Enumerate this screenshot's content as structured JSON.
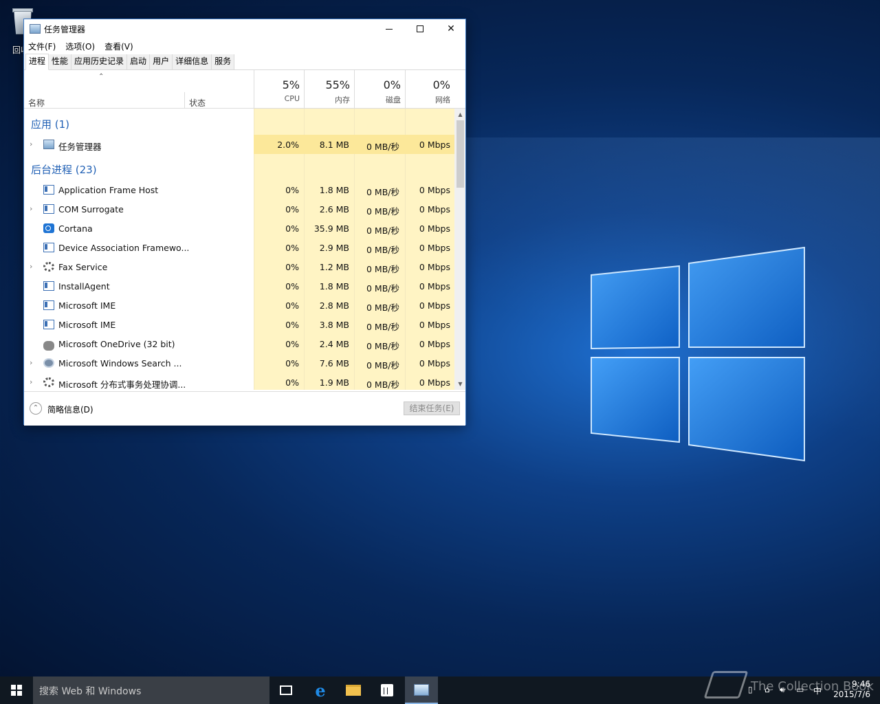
{
  "desktop": {
    "recycle_bin_label": "回收站"
  },
  "window": {
    "title": "任务管理器",
    "menu": [
      "文件(F)",
      "选项(O)",
      "查看(V)"
    ],
    "tabs": [
      "进程",
      "性能",
      "应用历史记录",
      "启动",
      "用户",
      "详细信息",
      "服务"
    ],
    "active_tab_index": 0,
    "columns": {
      "name": "名称",
      "status": "状态",
      "cpu": {
        "percent": "5%",
        "label": "CPU"
      },
      "memory": {
        "percent": "55%",
        "label": "内存"
      },
      "disk": {
        "percent": "0%",
        "label": "磁盘"
      },
      "network": {
        "percent": "0%",
        "label": "网络"
      }
    },
    "groups": {
      "apps": "应用 (1)",
      "background": "后台进程 (23)"
    },
    "apps": [
      {
        "name": "任务管理器",
        "icon": "task-manager-icon",
        "expandable": true,
        "cpu": "2.0%",
        "memory": "8.1 MB",
        "disk": "0 MB/秒",
        "network": "0 Mbps"
      }
    ],
    "background": [
      {
        "name": "Application Frame Host",
        "icon": "app-window-icon",
        "expandable": false,
        "cpu": "0%",
        "memory": "1.8 MB",
        "disk": "0 MB/秒",
        "network": "0 Mbps"
      },
      {
        "name": "COM Surrogate",
        "icon": "app-window-icon",
        "expandable": true,
        "cpu": "0%",
        "memory": "2.6 MB",
        "disk": "0 MB/秒",
        "network": "0 Mbps"
      },
      {
        "name": "Cortana",
        "icon": "cortana-icon",
        "expandable": false,
        "cpu": "0%",
        "memory": "35.9 MB",
        "disk": "0 MB/秒",
        "network": "0 Mbps"
      },
      {
        "name": "Device Association Framewo...",
        "icon": "app-window-icon",
        "expandable": false,
        "cpu": "0%",
        "memory": "2.9 MB",
        "disk": "0 MB/秒",
        "network": "0 Mbps"
      },
      {
        "name": "Fax Service",
        "icon": "gear-icon",
        "expandable": true,
        "cpu": "0%",
        "memory": "1.2 MB",
        "disk": "0 MB/秒",
        "network": "0 Mbps"
      },
      {
        "name": "InstallAgent",
        "icon": "app-window-icon",
        "expandable": false,
        "cpu": "0%",
        "memory": "1.8 MB",
        "disk": "0 MB/秒",
        "network": "0 Mbps"
      },
      {
        "name": "Microsoft IME",
        "icon": "app-window-icon",
        "expandable": false,
        "cpu": "0%",
        "memory": "2.8 MB",
        "disk": "0 MB/秒",
        "network": "0 Mbps"
      },
      {
        "name": "Microsoft IME",
        "icon": "app-window-icon",
        "expandable": false,
        "cpu": "0%",
        "memory": "3.8 MB",
        "disk": "0 MB/秒",
        "network": "0 Mbps"
      },
      {
        "name": "Microsoft OneDrive (32 bit)",
        "icon": "cloud-icon",
        "expandable": false,
        "cpu": "0%",
        "memory": "2.4 MB",
        "disk": "0 MB/秒",
        "network": "0 Mbps"
      },
      {
        "name": "Microsoft Windows Search ...",
        "icon": "user-icon",
        "expandable": true,
        "cpu": "0%",
        "memory": "7.6 MB",
        "disk": "0 MB/秒",
        "network": "0 Mbps"
      },
      {
        "name": "Microsoft 分布式事务处理协调...",
        "icon": "gear-icon",
        "expandable": true,
        "cpu": "0%",
        "memory": "1.9 MB",
        "disk": "0 MB/秒",
        "network": "0 Mbps"
      }
    ],
    "footer": {
      "fewer_details": "简略信息(D)",
      "end_task": "结束任务(E)"
    }
  },
  "taskbar": {
    "search_placeholder": "搜索 Web 和 Windows",
    "ime_indicator": "中",
    "time": "9:46",
    "date": "2015/7/6"
  },
  "watermark": "The Collection Book"
}
